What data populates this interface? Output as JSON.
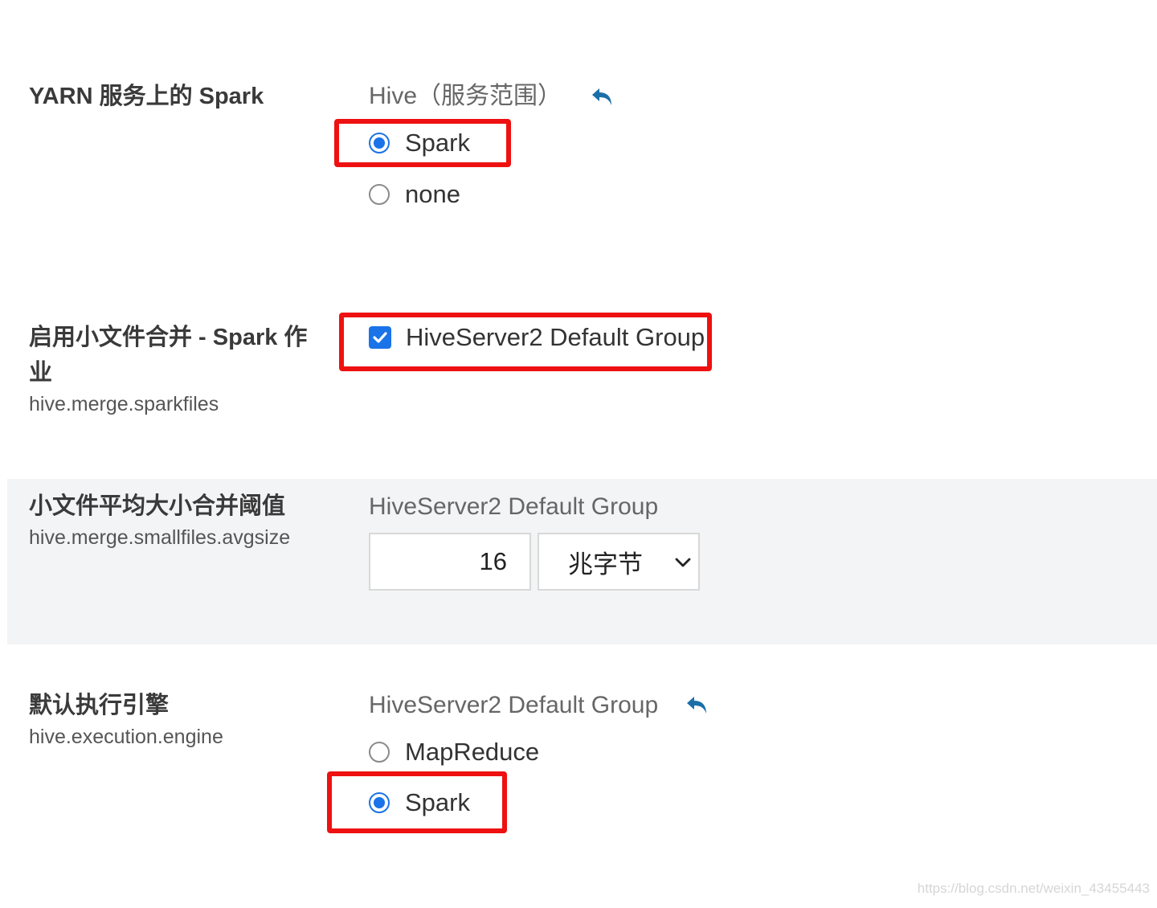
{
  "rows": [
    {
      "title": "YARN 服务上的 Spark",
      "key": "",
      "scope": "Hive（服务范围）",
      "has_undo": true,
      "control": "radio",
      "options": [
        {
          "label": "Spark",
          "checked": true,
          "highlighted": true
        },
        {
          "label": "none",
          "checked": false,
          "highlighted": false
        }
      ]
    },
    {
      "title_line1": "启用小文件合并 - Spark 作",
      "title_line2": "业",
      "key": "hive.merge.sparkfiles",
      "control": "checkbox",
      "checkbox": {
        "label": "HiveServer2 Default Group",
        "checked": true,
        "highlighted": true
      }
    },
    {
      "title": "小文件平均大小合并阈值",
      "key": "hive.merge.smallfiles.avgsize",
      "scope": "HiveServer2 Default Group",
      "control": "number-with-unit",
      "value": "16",
      "unit": "兆字节"
    },
    {
      "title": "默认执行引擎",
      "key": "hive.execution.engine",
      "scope": "HiveServer2 Default Group",
      "has_undo": true,
      "control": "radio",
      "options": [
        {
          "label": "MapReduce",
          "checked": false,
          "highlighted": false
        },
        {
          "label": "Spark",
          "checked": true,
          "highlighted": true
        }
      ]
    }
  ],
  "icons": {
    "undo": "undo-arrow-icon",
    "dropdown": "chevron-down-icon",
    "check": "check-icon"
  },
  "colors": {
    "accent": "#1a73e8",
    "highlight": "#ee1111",
    "undo_icon": "#1b6fa8",
    "alt_row_bg": "#f3f4f6"
  },
  "watermark": "https://blog.csdn.net/weixin_43455443"
}
